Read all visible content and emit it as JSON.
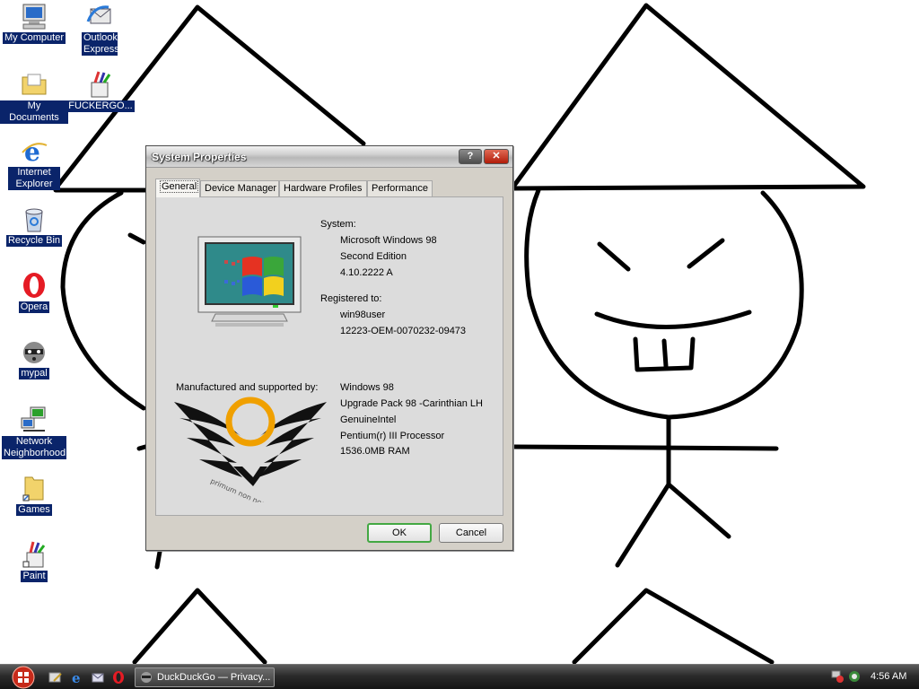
{
  "desktop": {
    "icons": [
      {
        "label": "My Computer"
      },
      {
        "label": "Outlook Express"
      },
      {
        "label": "My Documents"
      },
      {
        "label": "FUCKERGO..."
      },
      {
        "label": "Internet Explorer"
      },
      {
        "label": "Recycle Bin"
      },
      {
        "label": "Opera"
      },
      {
        "label": "mypal"
      },
      {
        "label": "Network Neighborhood"
      },
      {
        "label": "Games"
      },
      {
        "label": "Paint"
      }
    ]
  },
  "dialog": {
    "title": "System Properties",
    "help_label": "?",
    "close_label": "✕",
    "tabs": [
      "General",
      "Device Manager",
      "Hardware Profiles",
      "Performance"
    ],
    "system_heading": "System:",
    "system_lines": [
      "Microsoft Windows 98",
      "Second Edition",
      "4.10.2222 A"
    ],
    "registered_heading": "Registered to:",
    "registered_lines": [
      "win98user",
      "12223-OEM-0070232-09473"
    ],
    "manufacturer_heading": "Manufactured and supported by:",
    "manufacturer_lines": [
      "Windows 98",
      "Upgrade Pack 98 -Carinthian LH",
      "GenuineIntel",
      "Pentium(r) III Processor",
      "1536.0MB RAM"
    ],
    "logo_text": "primum non nocere",
    "ok_label": "OK",
    "cancel_label": "Cancel"
  },
  "taskbar": {
    "task_label": "DuckDuckGo — Privacy...",
    "clock": "4:56 AM"
  },
  "colors": {
    "selection": "#0a246a",
    "dialog_face": "#d4d0c8",
    "ok_border": "#43a843",
    "logo_ring": "#f0a000"
  }
}
